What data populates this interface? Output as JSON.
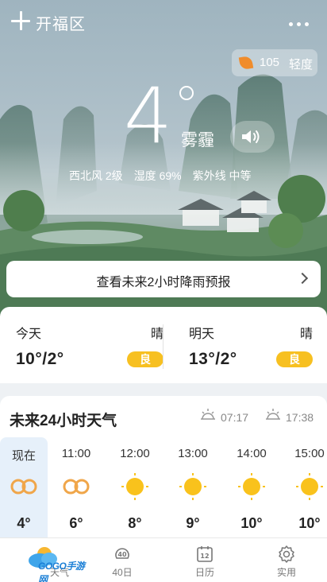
{
  "header": {
    "city": "开福区"
  },
  "aqi": {
    "value": "105",
    "level": "轻度"
  },
  "current": {
    "temperature": "4",
    "condition": "雾霾",
    "wind": "西北风 2级",
    "humidity": "湿度 69%",
    "uv": "紫外线 中等"
  },
  "rain_forecast": {
    "text": "查看未来2小时降雨预报"
  },
  "daily": [
    {
      "day": "今天",
      "weather": "晴",
      "range": "10°/2°",
      "air": "良"
    },
    {
      "day": "明天",
      "weather": "晴",
      "range": "13°/2°",
      "air": "良"
    }
  ],
  "hourly": {
    "title": "未来24小时天气",
    "sunrise": "07:17",
    "sunset": "17:38",
    "items": [
      {
        "time": "现在",
        "icon": "haze-icon",
        "temp": "4°"
      },
      {
        "time": "11:00",
        "icon": "haze-icon",
        "temp": "6°"
      },
      {
        "time": "12:00",
        "icon": "sun-icon",
        "temp": "8°"
      },
      {
        "time": "13:00",
        "icon": "sun-icon",
        "temp": "9°"
      },
      {
        "time": "14:00",
        "icon": "sun-icon",
        "temp": "10°"
      },
      {
        "time": "15:00",
        "icon": "sun-icon",
        "temp": "10°"
      }
    ]
  },
  "nav": {
    "items": [
      {
        "label": "天气",
        "icon": "weather-icon"
      },
      {
        "label": "40日",
        "icon": "forty-day-icon",
        "badge": "40"
      },
      {
        "label": "日历",
        "icon": "calendar-icon",
        "badge": "12"
      },
      {
        "label": "实用",
        "icon": "gear-icon"
      }
    ],
    "watermark": "GOGO手游网"
  },
  "colors": {
    "aqi_badge": "#f7c021",
    "accent_blue": "#1b7fd6",
    "sun": "#f9c21c",
    "haze": "#f0a64a"
  }
}
